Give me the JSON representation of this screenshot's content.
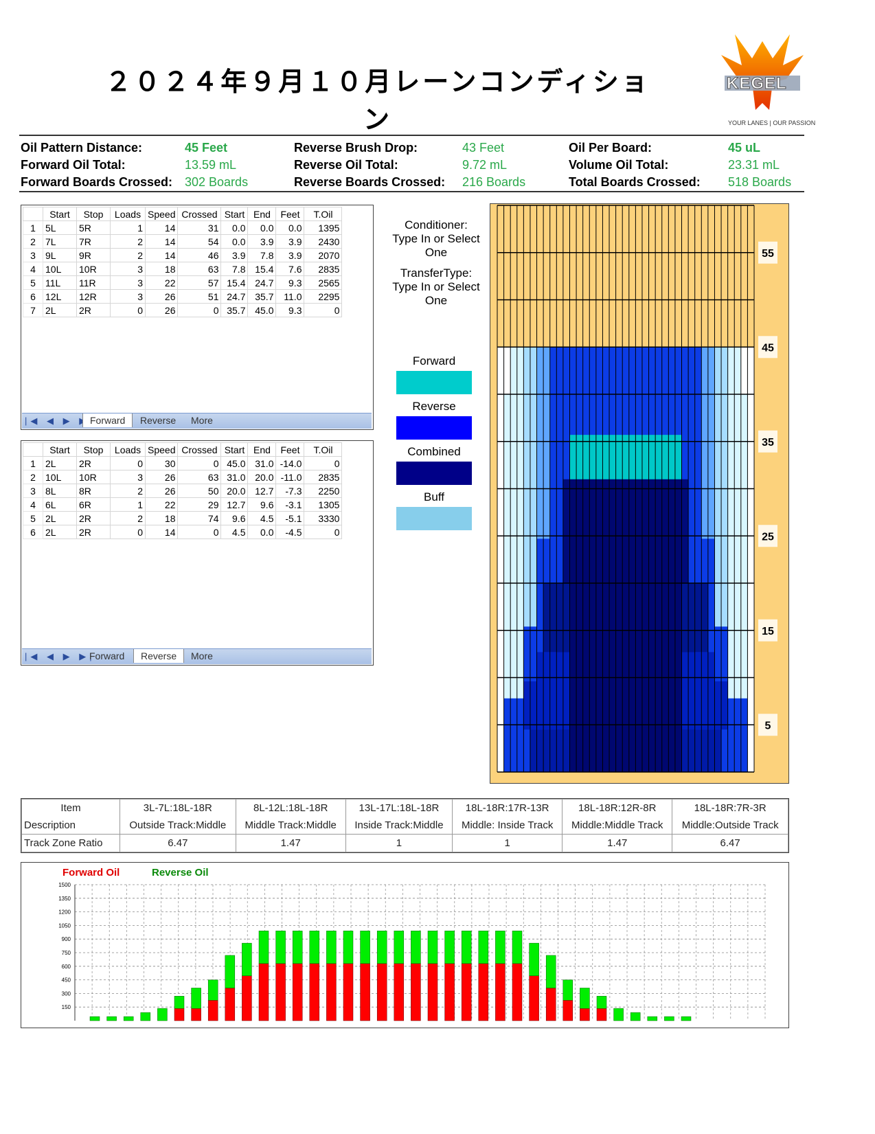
{
  "title": "２０２４年９月１０月レーンコンディション",
  "logo": {
    "text": "KEGEL",
    "tagline_left": "YOUR LANES",
    "tagline_right": "OUR PASSION"
  },
  "summary": {
    "oil_pattern_distance": {
      "label": "Oil Pattern Distance:",
      "value": "45 Feet"
    },
    "forward_oil_total": {
      "label": "Forward Oil Total:",
      "value": "13.59 mL"
    },
    "forward_boards_crossed": {
      "label": "Forward Boards Crossed:",
      "value": "302 Boards"
    },
    "reverse_brush_drop": {
      "label": "Reverse Brush Drop:",
      "value": "43 Feet"
    },
    "reverse_oil_total": {
      "label": "Reverse Oil Total:",
      "value": "9.72 mL"
    },
    "reverse_boards_crossed": {
      "label": "Reverse Boards Crossed:",
      "value": "216 Boards"
    },
    "oil_per_board": {
      "label": "Oil Per Board:",
      "value": "45 uL"
    },
    "volume_oil_total": {
      "label": "Volume Oil Total:",
      "value": "23.31 mL"
    },
    "total_boards_crossed": {
      "label": "Total Boards Crossed:",
      "value": "518 Boards"
    }
  },
  "grid_headers": [
    "Start",
    "Stop",
    "Loads",
    "Speed",
    "Crossed",
    "Start",
    "End",
    "Feet",
    "T.Oil"
  ],
  "forward_grid": {
    "rows": [
      [
        "1",
        "5L",
        "5R",
        "1",
        "14",
        "31",
        "0.0",
        "0.0",
        "0.0",
        "1395"
      ],
      [
        "2",
        "7L",
        "7R",
        "2",
        "14",
        "54",
        "0.0",
        "3.9",
        "3.9",
        "2430"
      ],
      [
        "3",
        "9L",
        "9R",
        "2",
        "14",
        "46",
        "3.9",
        "7.8",
        "3.9",
        "2070"
      ],
      [
        "4",
        "10L",
        "10R",
        "3",
        "18",
        "63",
        "7.8",
        "15.4",
        "7.6",
        "2835"
      ],
      [
        "5",
        "11L",
        "11R",
        "3",
        "22",
        "57",
        "15.4",
        "24.7",
        "9.3",
        "2565"
      ],
      [
        "6",
        "12L",
        "12R",
        "3",
        "26",
        "51",
        "24.7",
        "35.7",
        "11.0",
        "2295"
      ],
      [
        "7",
        "2L",
        "2R",
        "0",
        "26",
        "0",
        "35.7",
        "45.0",
        "9.3",
        "0"
      ]
    ]
  },
  "reverse_grid": {
    "rows": [
      [
        "1",
        "2L",
        "2R",
        "0",
        "30",
        "0",
        "45.0",
        "31.0",
        "-14.0",
        "0"
      ],
      [
        "2",
        "10L",
        "10R",
        "3",
        "26",
        "63",
        "31.0",
        "20.0",
        "-11.0",
        "2835"
      ],
      [
        "3",
        "8L",
        "8R",
        "2",
        "26",
        "50",
        "20.0",
        "12.7",
        "-7.3",
        "2250"
      ],
      [
        "4",
        "6L",
        "6R",
        "1",
        "22",
        "29",
        "12.7",
        "9.6",
        "-3.1",
        "1305"
      ],
      [
        "5",
        "2L",
        "2R",
        "2",
        "18",
        "74",
        "9.6",
        "4.5",
        "-5.1",
        "3330"
      ],
      [
        "6",
        "2L",
        "2R",
        "0",
        "14",
        "0",
        "4.5",
        "0.0",
        "-4.5",
        "0"
      ]
    ]
  },
  "tabs": {
    "nav": "|◀ ◀ ▶ ▶|",
    "forward": "Forward",
    "reverse": "Reverse",
    "more": "More"
  },
  "conditioner": {
    "line1": "Conditioner:",
    "line2": "Type In or Select",
    "line3": "One"
  },
  "transfer": {
    "line1": "TransferType:",
    "line2": "Type In or Select",
    "line3": "One"
  },
  "legend": [
    {
      "label": "Forward",
      "color": "#00cccc"
    },
    {
      "label": "Reverse",
      "color": "#0000ff"
    },
    {
      "label": "Combined",
      "color": "#000088"
    },
    {
      "label": "Buff",
      "color": "#87ceeb"
    }
  ],
  "lane_axis_labels": [
    "55",
    "45",
    "35",
    "25",
    "15",
    "5"
  ],
  "zone_table": {
    "head_item": "Item",
    "head_desc": "Description",
    "row_label": "Track Zone Ratio",
    "columns": [
      {
        "range": "3L-7L:18L-18R",
        "desc": "Outside Track:Middle",
        "ratio": "6.47"
      },
      {
        "range": "8L-12L:18L-18R",
        "desc": "Middle Track:Middle",
        "ratio": "1.47"
      },
      {
        "range": "13L-17L:18L-18R",
        "desc": "Inside Track:Middle",
        "ratio": "1"
      },
      {
        "range": "18L-18R:17R-13R",
        "desc": "Middle: Inside Track",
        "ratio": "1"
      },
      {
        "range": "18L-18R:12R-8R",
        "desc": "Middle:Middle Track",
        "ratio": "1.47"
      },
      {
        "range": "18L-18R:7R-3R",
        "desc": "Middle:Outside Track",
        "ratio": "6.47"
      }
    ]
  },
  "chart_data": {
    "type": "bar",
    "stacked": true,
    "legend": [
      "Forward Oil",
      "Reverse Oil"
    ],
    "series_colors": {
      "forward": "#ff0000",
      "reverse": "#00ee00"
    },
    "ylim": [
      0,
      1500
    ],
    "yticks": [
      "1500",
      "1350",
      "1200",
      "1050",
      "900",
      "750",
      "600",
      "450",
      "300",
      "150"
    ],
    "forward": [
      0,
      0,
      0,
      0,
      0,
      135,
      135,
      225,
      360,
      495,
      630,
      630,
      630,
      630,
      630,
      630,
      630,
      630,
      630,
      630,
      630,
      630,
      630,
      630,
      630,
      630,
      495,
      360,
      225,
      135,
      135,
      0,
      0,
      0,
      0,
      0
    ],
    "reverse": [
      45,
      45,
      45,
      90,
      135,
      135,
      225,
      225,
      360,
      360,
      360,
      360,
      360,
      360,
      360,
      360,
      360,
      360,
      360,
      360,
      360,
      360,
      360,
      360,
      360,
      360,
      360,
      360,
      225,
      225,
      135,
      135,
      90,
      45,
      45,
      45
    ]
  }
}
